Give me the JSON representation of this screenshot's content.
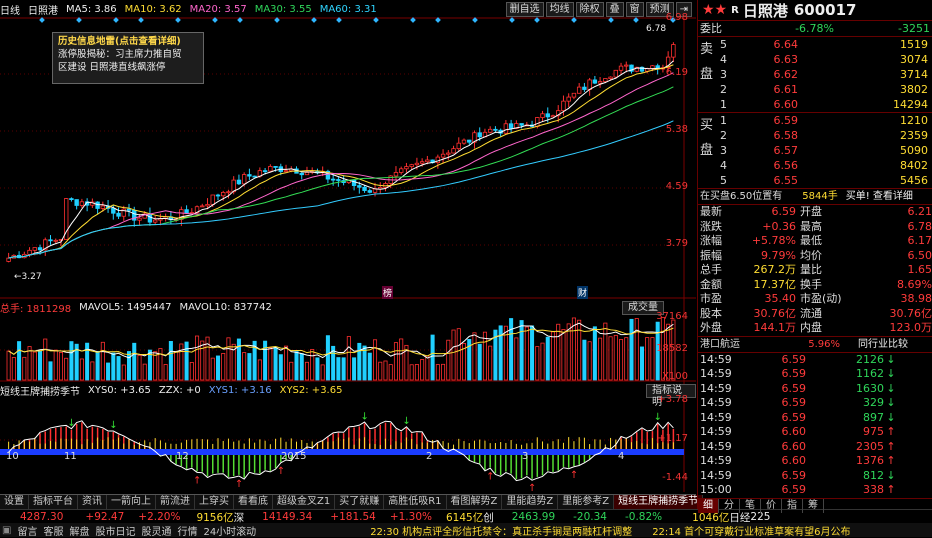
{
  "toolbar": {
    "period": "日线",
    "stock": "日照港",
    "ma5": "MA5: 3.86",
    "ma10": "MA10: 3.62",
    "ma20": "MA20: 3.57",
    "ma30": "MA30: 3.55",
    "ma60": "MA60: 3.31",
    "buttons": [
      "删自选",
      "均线",
      "除权",
      "叠",
      "窗",
      "预测"
    ]
  },
  "tooltip": {
    "title": "历史信息地雷(点击查看详细)",
    "line1": "涨停股揭秘：习主席力推自贸",
    "line2": "区建设 日照港直线飙涨停"
  },
  "price_axis": [
    "6.98",
    "6.19",
    "5.38",
    "4.59",
    "3.79"
  ],
  "price_high_label": "6.78",
  "price_low_label": "3.27",
  "event_marks": [
    "榜",
    "财"
  ],
  "volume": {
    "header_total": "总手: 1811298",
    "mavol5": "MAVOL5: 1495447",
    "mavol10": "MAVOL10: 837742",
    "button": "成交量",
    "axis": [
      "37164",
      "18582",
      "X100"
    ]
  },
  "indicator": {
    "name": "短线王牌捕捞季节",
    "xys0": "XYS0: +3.65",
    "zzx": "ZZX: +0",
    "xys1": "XYS1: +3.16",
    "xys2": "XYS2: +3.65",
    "button": "指标说明",
    "axis": [
      "+3.78",
      "+1.17",
      "-1.44"
    ],
    "date_labels": [
      "10",
      "11",
      "12",
      "2015",
      "2",
      "3",
      "4"
    ]
  },
  "tabs": [
    "设置",
    "指标平台",
    "资讯",
    "一箭向上",
    "箭流进",
    "上穿买",
    "看看底",
    "超级金叉Z1",
    "买了就赚",
    "高胜低吸R1",
    "看图解势Z",
    "里能趋势Z",
    "里能参考Z",
    "短线王牌捕捞季节"
  ],
  "status1": {
    "sh_index": "4287.30",
    "sh_change": "+92.47",
    "sh_pct": "+2.20%",
    "sh_amount": "9156亿",
    "sz_label": "深",
    "sz_index": "14149.34",
    "sz_change": "+181.54",
    "sz_pct": "+1.30%",
    "sz_amount": "6145亿",
    "cy_label": "创",
    "cy_index": "2463.99",
    "cy_change": "-20.34",
    "cy_pct": "-0.82%",
    "news1": "22:30 机构点评全彤信托禁令：真正杀手锏是两融杠杆调整",
    "news2": "22:14 首个可穿戴行业标准草案有望6月公布"
  },
  "status2": [
    "留言",
    "客服",
    "解盘",
    "股市日记",
    "股灵通",
    "行情",
    "24小时滚动"
  ],
  "quote": {
    "flag": "R",
    "name": "日照港",
    "code": "600017",
    "weibi_label": "委比",
    "weibi": "-6.78%",
    "weicha": "-3251",
    "sell_label": "卖盘",
    "buy_label": "买盘",
    "sells": [
      {
        "n": "5",
        "price": "6.64",
        "vol": "1519"
      },
      {
        "n": "4",
        "price": "6.63",
        "vol": "3074"
      },
      {
        "n": "3",
        "price": "6.62",
        "vol": "3714"
      },
      {
        "n": "2",
        "price": "6.61",
        "vol": "3802"
      },
      {
        "n": "1",
        "price": "6.60",
        "vol": "14294"
      }
    ],
    "buys": [
      {
        "n": "1",
        "price": "6.59",
        "vol": "1210"
      },
      {
        "n": "2",
        "price": "6.58",
        "vol": "2359"
      },
      {
        "n": "3",
        "price": "6.57",
        "vol": "5090"
      },
      {
        "n": "4",
        "price": "6.56",
        "vol": "8402"
      },
      {
        "n": "5",
        "price": "6.55",
        "vol": "5456"
      }
    ],
    "position_note": "在买盘6.50位置有",
    "position_vol": "5844手",
    "buy_one": "买单! 查看详细",
    "stats": [
      {
        "l1": "最新",
        "v1": "6.59",
        "l2": "开盘",
        "v2": "6.21"
      },
      {
        "l1": "涨跌",
        "v1": "+0.36",
        "l2": "最高",
        "v2": "6.78"
      },
      {
        "l1": "涨幅",
        "v1": "+5.78%",
        "l2": "最低",
        "v2": "6.17"
      },
      {
        "l1": "振幅",
        "v1": "9.79%",
        "l2": "均价",
        "v2": "6.50"
      },
      {
        "l1": "总手",
        "v1": "267.2万",
        "l2": "量比",
        "v2": "1.65"
      },
      {
        "l1": "金额",
        "v1": "17.37亿",
        "l2": "换手",
        "v2": "8.69%"
      },
      {
        "l1": "市盈",
        "v1": "35.40",
        "l2": "市盈(动)",
        "v2": "38.98"
      },
      {
        "l1": "股本",
        "v1": "30.76亿",
        "l2": "流通",
        "v2": "30.76亿"
      },
      {
        "l1": "外盘",
        "v1": "144.1万",
        "l2": "内盘",
        "v2": "123.0万"
      }
    ],
    "sector": "港口航运",
    "sector_pct": "5.96%",
    "sector_compare": "同行业比较",
    "ticks": [
      {
        "t": "14:59",
        "p": "6.59",
        "v": "2126",
        "d": "down"
      },
      {
        "t": "14:59",
        "p": "6.59",
        "v": "1162",
        "d": "down"
      },
      {
        "t": "14:59",
        "p": "6.59",
        "v": "1630",
        "d": "down"
      },
      {
        "t": "14:59",
        "p": "6.59",
        "v": "329",
        "d": "down"
      },
      {
        "t": "14:59",
        "p": "6.59",
        "v": "897",
        "d": "down"
      },
      {
        "t": "14:59",
        "p": "6.60",
        "v": "975",
        "d": "up"
      },
      {
        "t": "14:59",
        "p": "6.60",
        "v": "2305",
        "d": "up"
      },
      {
        "t": "14:59",
        "p": "6.60",
        "v": "1376",
        "d": "up"
      },
      {
        "t": "14:59",
        "p": "6.59",
        "v": "812",
        "d": "down"
      },
      {
        "t": "15:00",
        "p": "6.59",
        "v": "338",
        "d": "up"
      }
    ],
    "bottom_tabs": [
      "细",
      "分",
      "笔",
      "价",
      "指",
      "筹"
    ],
    "rijing_amount": "1046亿",
    "rijing_label": "日经",
    "rijing_value": "225"
  }
}
